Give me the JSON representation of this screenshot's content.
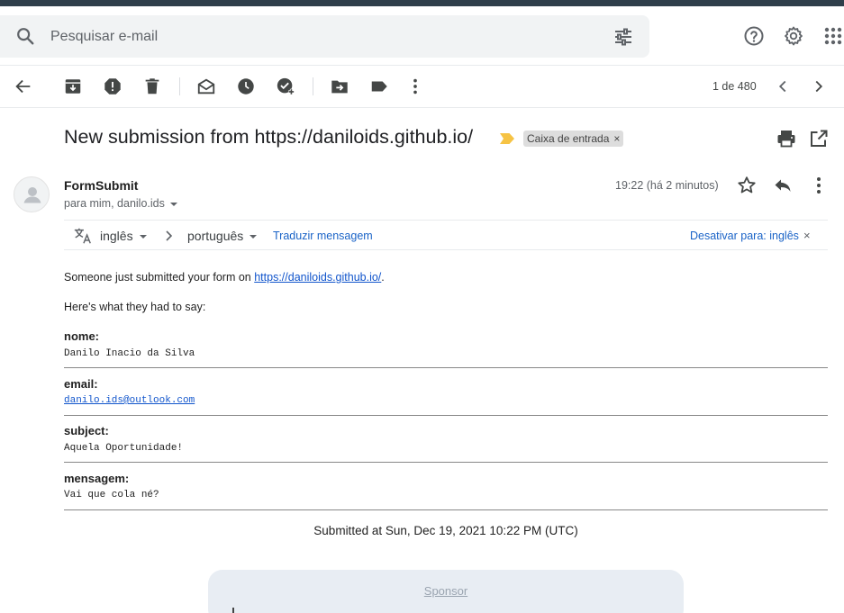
{
  "search": {
    "placeholder": "Pesquisar e-mail"
  },
  "toolbar": {
    "pager": "1 de 480"
  },
  "message": {
    "subject": "New submission from https://daniloids.github.io/",
    "label": "Caixa de entrada",
    "label_close": "×",
    "sender": "FormSubmit",
    "recipients": "para mim, danilo.ids",
    "time": "19:22 (há 2 minutos)"
  },
  "translate": {
    "from": "inglês",
    "to": "português",
    "action": "Traduzir mensagem",
    "disable": "Desativar para: inglês",
    "close": "×"
  },
  "body": {
    "intro_prefix": "Someone just submitted your form on ",
    "intro_link": "https://daniloids.github.io/",
    "intro_suffix": ".",
    "say": "Here's what they had to say:",
    "fields": [
      {
        "label": "nome:",
        "value": "Danilo Inacio da Silva"
      },
      {
        "label": "email:",
        "value": "danilo.ids@outlook.com"
      },
      {
        "label": "subject:",
        "value": "Aquela Oportunidade!"
      },
      {
        "label": "mensagem:",
        "value": "Vai que cola né?"
      }
    ],
    "submitted": "Submitted at Sun, Dec 19, 2021 10:22 PM (UTC)",
    "sponsor": "Sponsor"
  }
}
